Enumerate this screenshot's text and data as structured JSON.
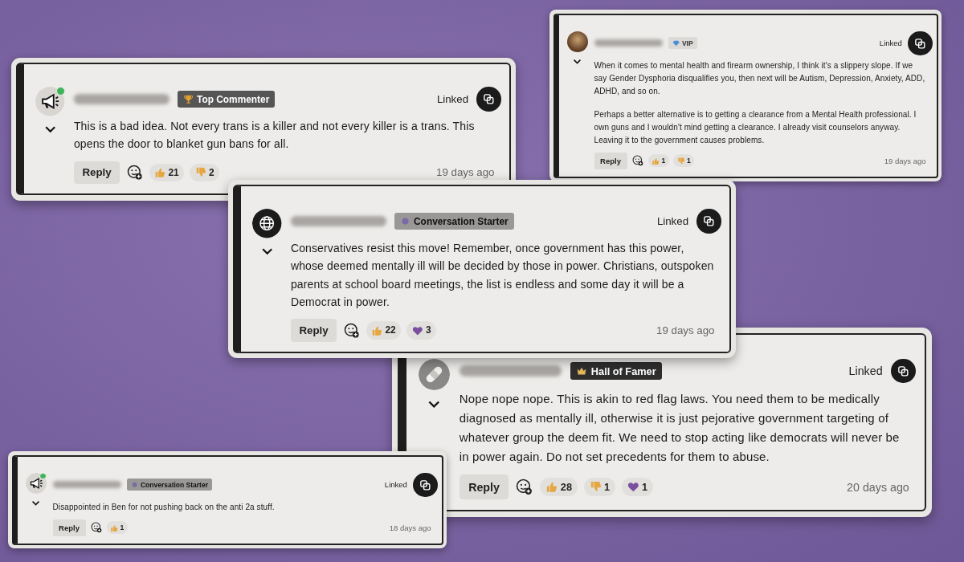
{
  "comments": [
    {
      "avatar": {
        "kind": "megaphone"
      },
      "online": true,
      "badge": {
        "kind": "trophy",
        "label": "Top Commenter"
      },
      "linked": "Linked",
      "paragraphs": [
        "This is a bad idea. Not every trans is a killer and not every killer is a trans. This opens the door to blanket gun bans for all."
      ],
      "reply": "Reply",
      "reactions": [
        {
          "kind": "thumbs-up",
          "count": "21"
        },
        {
          "kind": "thumbs-down",
          "count": "2"
        }
      ],
      "time": "19 days ago"
    },
    {
      "avatar": {
        "kind": "photo"
      },
      "online": false,
      "badge": {
        "kind": "diamond",
        "label": "VIP"
      },
      "linked": "Linked",
      "paragraphs": [
        "When it comes to mental health and firearm ownership, I think it's a slippery slope. If we say Gender Dysphoria disqualifies you, then next will be Autism, Depression, Anxiety, ADD, ADHD, and so on.",
        "Perhaps a better alternative is to getting a clearance from a Mental Health professional. I own guns and I wouldn't mind getting a clearance. I already visit counselors anyway. Leaving it to the government causes problems."
      ],
      "reply": "Reply",
      "reactions": [
        {
          "kind": "thumbs-up",
          "count": "1"
        },
        {
          "kind": "thumbs-down",
          "count": "1"
        }
      ],
      "time": "19 days ago"
    },
    {
      "avatar": {
        "kind": "bandage"
      },
      "online": false,
      "badge": {
        "kind": "crown",
        "label": "Hall of Famer"
      },
      "linked": "Linked",
      "paragraphs": [
        "Nope nope nope. This is akin to red flag laws. You need them to be medically diagnosed as mentally ill, otherwise it is just pejorative government targeting of whatever group the deem fit. We need to stop acting like democrats will never be in power again. Do not set precedents for them to abuse."
      ],
      "reply": "Reply",
      "reactions": [
        {
          "kind": "thumbs-up",
          "count": "28"
        },
        {
          "kind": "thumbs-down",
          "count": "1"
        },
        {
          "kind": "heart",
          "count": "1"
        }
      ],
      "time": "20 days ago"
    },
    {
      "avatar": {
        "kind": "globe"
      },
      "online": false,
      "badge": {
        "kind": "dot",
        "label": "Conversation Starter"
      },
      "linked": "Linked",
      "paragraphs": [
        "Conservatives resist this move! Remember, once government has this power, whose deemed mentally ill will be decided by those in power. Christians, outspoken parents at school board meetings, the list is endless and some day it will be a Democrat in power."
      ],
      "reply": "Reply",
      "reactions": [
        {
          "kind": "thumbs-up",
          "count": "22"
        },
        {
          "kind": "heart",
          "count": "3"
        }
      ],
      "time": "19 days ago"
    },
    {
      "avatar": {
        "kind": "megaphone"
      },
      "online": true,
      "badge": {
        "kind": "dot",
        "label": "Conversation Starter"
      },
      "linked": "Linked",
      "paragraphs": [
        "Disappointed in Ben for not pushing back on the anti 2a stuff."
      ],
      "reply": "Reply",
      "reactions": [
        {
          "kind": "thumbs-up",
          "count": "1"
        }
      ],
      "time": "18 days ago"
    }
  ]
}
